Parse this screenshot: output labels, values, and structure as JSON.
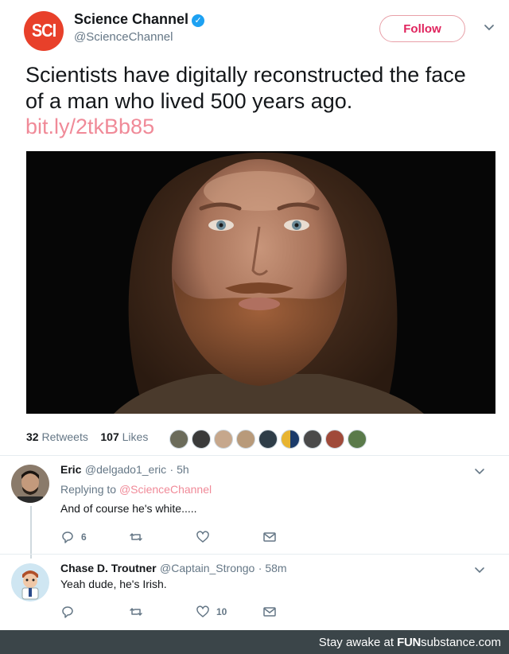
{
  "tweet": {
    "author_name": "Science Channel",
    "author_handle": "@ScienceChannel",
    "avatar_text": "SCI",
    "verified_icon": "verified-check-icon",
    "follow_label": "Follow",
    "text": "Scientists have digitally reconstructed the face of a man who lived 500 years ago.",
    "link": "bit.ly/2tkBb85",
    "retweets_count": "32",
    "retweets_label": "Retweets",
    "likes_count": "107",
    "likes_label": "Likes",
    "liker_avatars": 9
  },
  "replies": [
    {
      "name": "Eric",
      "handle": "@delgado1_eric",
      "time": "· 5h",
      "replying_to_label": "Replying to",
      "replying_to_handle": "@ScienceChannel",
      "text": "And of course he's white.....",
      "reply_count": "6",
      "retweet_count": "",
      "like_count": ""
    },
    {
      "name": "Chase D. Troutner",
      "handle": "@Captain_Strongo",
      "time": "· 58m",
      "text": "Yeah dude, he's Irish.",
      "reply_count": "",
      "retweet_count": "",
      "like_count": "10"
    }
  ],
  "footer": {
    "prefix": "Stay awake at",
    "brand_a": "FUN",
    "brand_b": "substance",
    "brand_c": ".com"
  },
  "colors": {
    "accent_pink": "#f08a98",
    "follow_red": "#e0245e",
    "verified_blue": "#1da1f2",
    "avatar_red": "#e8402a",
    "footer_bg": "#3b4549"
  }
}
